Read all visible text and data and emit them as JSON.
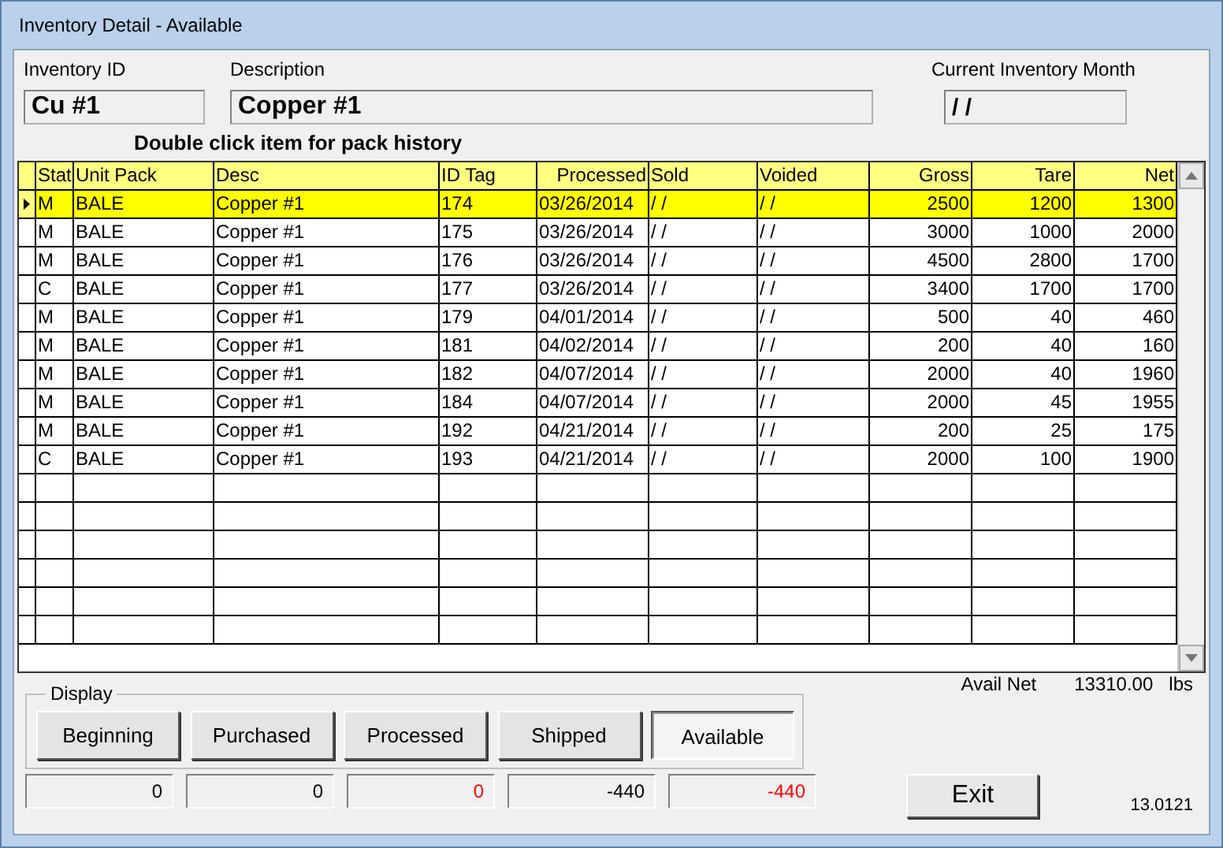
{
  "window": {
    "title": "Inventory Detail - Available"
  },
  "fields": {
    "inventory_id": {
      "label": "Inventory ID",
      "value": "Cu #1"
    },
    "description": {
      "label": "Description",
      "value": "Copper #1"
    },
    "month": {
      "label": "Current Inventory Month",
      "value": "/ /"
    }
  },
  "hint": "Double click item for pack history",
  "table": {
    "columns": [
      {
        "label": "Stat",
        "kind": "text"
      },
      {
        "label": "Unit Pack",
        "kind": "text"
      },
      {
        "label": "Desc",
        "kind": "text"
      },
      {
        "label": "ID Tag",
        "kind": "text"
      },
      {
        "label": "Processed",
        "kind": "date"
      },
      {
        "label": "Sold",
        "kind": "text"
      },
      {
        "label": "Voided",
        "kind": "text"
      },
      {
        "label": "Gross",
        "kind": "number"
      },
      {
        "label": "Tare",
        "kind": "number"
      },
      {
        "label": "Net",
        "kind": "number"
      }
    ],
    "rows": [
      {
        "selected": true,
        "cells": [
          "M",
          "BALE",
          "Copper #1",
          "174",
          "03/26/2014",
          "/ /",
          "/ /",
          "2500",
          "1200",
          "1300"
        ]
      },
      {
        "selected": false,
        "cells": [
          "M",
          "BALE",
          "Copper #1",
          "175",
          "03/26/2014",
          "/ /",
          "/ /",
          "3000",
          "1000",
          "2000"
        ]
      },
      {
        "selected": false,
        "cells": [
          "M",
          "BALE",
          "Copper #1",
          "176",
          "03/26/2014",
          "/ /",
          "/ /",
          "4500",
          "2800",
          "1700"
        ]
      },
      {
        "selected": false,
        "cells": [
          "C",
          "BALE",
          "Copper #1",
          "177",
          "03/26/2014",
          "/ /",
          "/ /",
          "3400",
          "1700",
          "1700"
        ]
      },
      {
        "selected": false,
        "cells": [
          "M",
          "BALE",
          "Copper #1",
          "179",
          "04/01/2014",
          "/ /",
          "/ /",
          "500",
          "40",
          "460"
        ]
      },
      {
        "selected": false,
        "cells": [
          "M",
          "BALE",
          "Copper #1",
          "181",
          "04/02/2014",
          "/ /",
          "/ /",
          "200",
          "40",
          "160"
        ]
      },
      {
        "selected": false,
        "cells": [
          "M",
          "BALE",
          "Copper #1",
          "182",
          "04/07/2014",
          "/ /",
          "/ /",
          "2000",
          "40",
          "1960"
        ]
      },
      {
        "selected": false,
        "cells": [
          "M",
          "BALE",
          "Copper #1",
          "184",
          "04/07/2014",
          "/ /",
          "/ /",
          "2000",
          "45",
          "1955"
        ]
      },
      {
        "selected": false,
        "cells": [
          "M",
          "BALE",
          "Copper #1",
          "192",
          "04/21/2014",
          "/ /",
          "/ /",
          "200",
          "25",
          "175"
        ]
      },
      {
        "selected": false,
        "cells": [
          "C",
          "BALE",
          "Copper #1",
          "193",
          "04/21/2014",
          "/ /",
          "/ /",
          "2000",
          "100",
          "1900"
        ]
      }
    ]
  },
  "avail_net": {
    "label": "Avail Net",
    "value": "13310.00",
    "unit": "lbs"
  },
  "display": {
    "label": "Display",
    "buttons": [
      {
        "label": "Beginning",
        "selected": false
      },
      {
        "label": "Purchased",
        "selected": false
      },
      {
        "label": "Processed",
        "selected": false
      },
      {
        "label": "Shipped",
        "selected": false
      },
      {
        "label": "Available",
        "selected": true
      }
    ],
    "totals": [
      {
        "value": "0",
        "color": "#000000"
      },
      {
        "value": "0",
        "color": "#000000"
      },
      {
        "value": "0",
        "color": "#ff0000"
      },
      {
        "value": "-440",
        "color": "#000000"
      },
      {
        "value": "-440",
        "color": "#ff0000"
      }
    ]
  },
  "exit_button": "Exit",
  "version": "13.0121"
}
